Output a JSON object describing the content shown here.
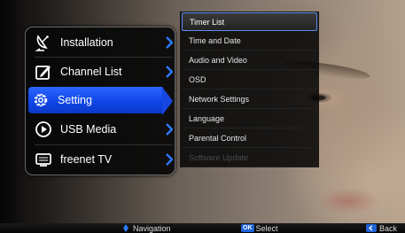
{
  "main_menu": {
    "items": [
      {
        "label": "Installation",
        "icon": "satellite-dish-icon",
        "has_arrow": true
      },
      {
        "label": "Channel List",
        "icon": "edit-list-icon",
        "has_arrow": true
      },
      {
        "label": "Setting",
        "icon": "gear-icon",
        "selected": true
      },
      {
        "label": "USB Media",
        "icon": "play-circle-icon",
        "has_arrow": true
      },
      {
        "label": "freenet TV",
        "icon": "tv-icon",
        "has_arrow": true
      }
    ]
  },
  "sub_menu": {
    "items": [
      {
        "label": "Timer List",
        "active": true
      },
      {
        "label": "Time and Date"
      },
      {
        "label": "Audio and Video"
      },
      {
        "label": "OSD"
      },
      {
        "label": "Network Settings"
      },
      {
        "label": "Language"
      },
      {
        "label": "Parental Control"
      },
      {
        "label": "Software Update",
        "disabled": true
      }
    ]
  },
  "bottom_bar": {
    "navigation_label": "Navigation",
    "ok_key": "OK",
    "select_label": "Select",
    "back_label": "Back"
  },
  "colors": {
    "accent": "#1647e0",
    "arrow": "#2a7bff",
    "disabled_text": "#4a4a4a"
  }
}
